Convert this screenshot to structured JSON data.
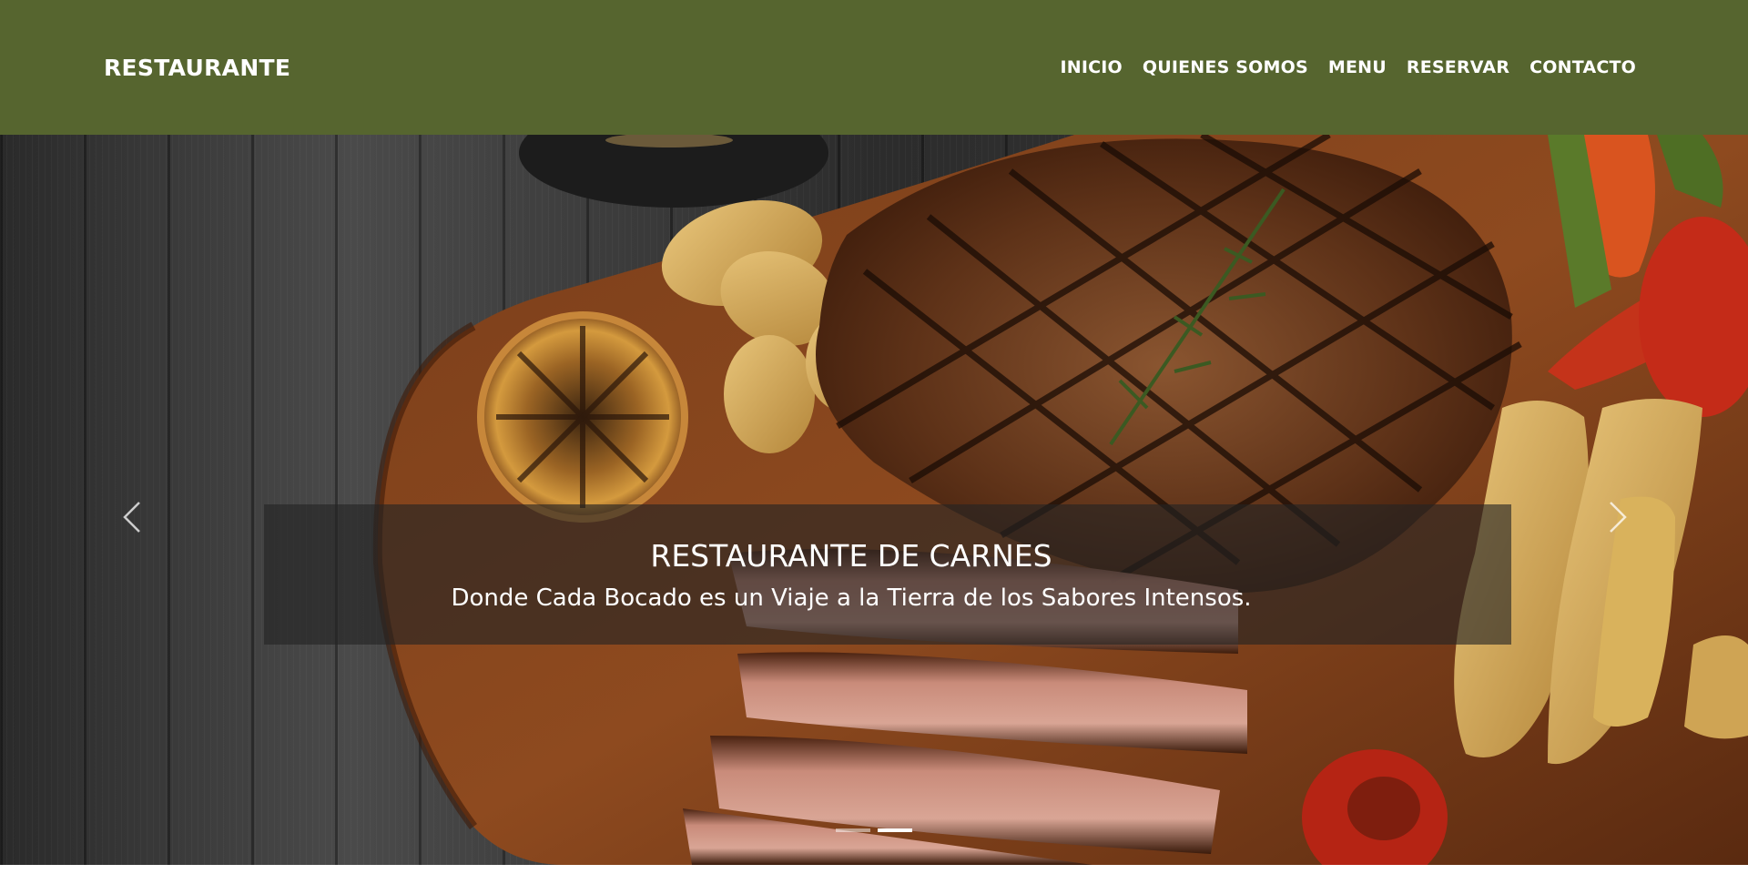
{
  "navbar": {
    "brand": "RESTAURANTE",
    "links": [
      {
        "label": "INICIO"
      },
      {
        "label": "QUIENES SOMOS"
      },
      {
        "label": "MENU"
      },
      {
        "label": "RESERVAR"
      },
      {
        "label": "CONTACTO"
      }
    ],
    "background_color": "#56652f"
  },
  "hero": {
    "title": "RESTAURANTE DE CARNES",
    "subtitle": "Donde Cada Bocado es un Viaje a la Tierra de los Sabores Intensos.",
    "controls": {
      "prev_icon": "chevron-left-icon",
      "next_icon": "chevron-right-icon"
    },
    "indicators": {
      "count": 2,
      "active_index": 1
    }
  }
}
